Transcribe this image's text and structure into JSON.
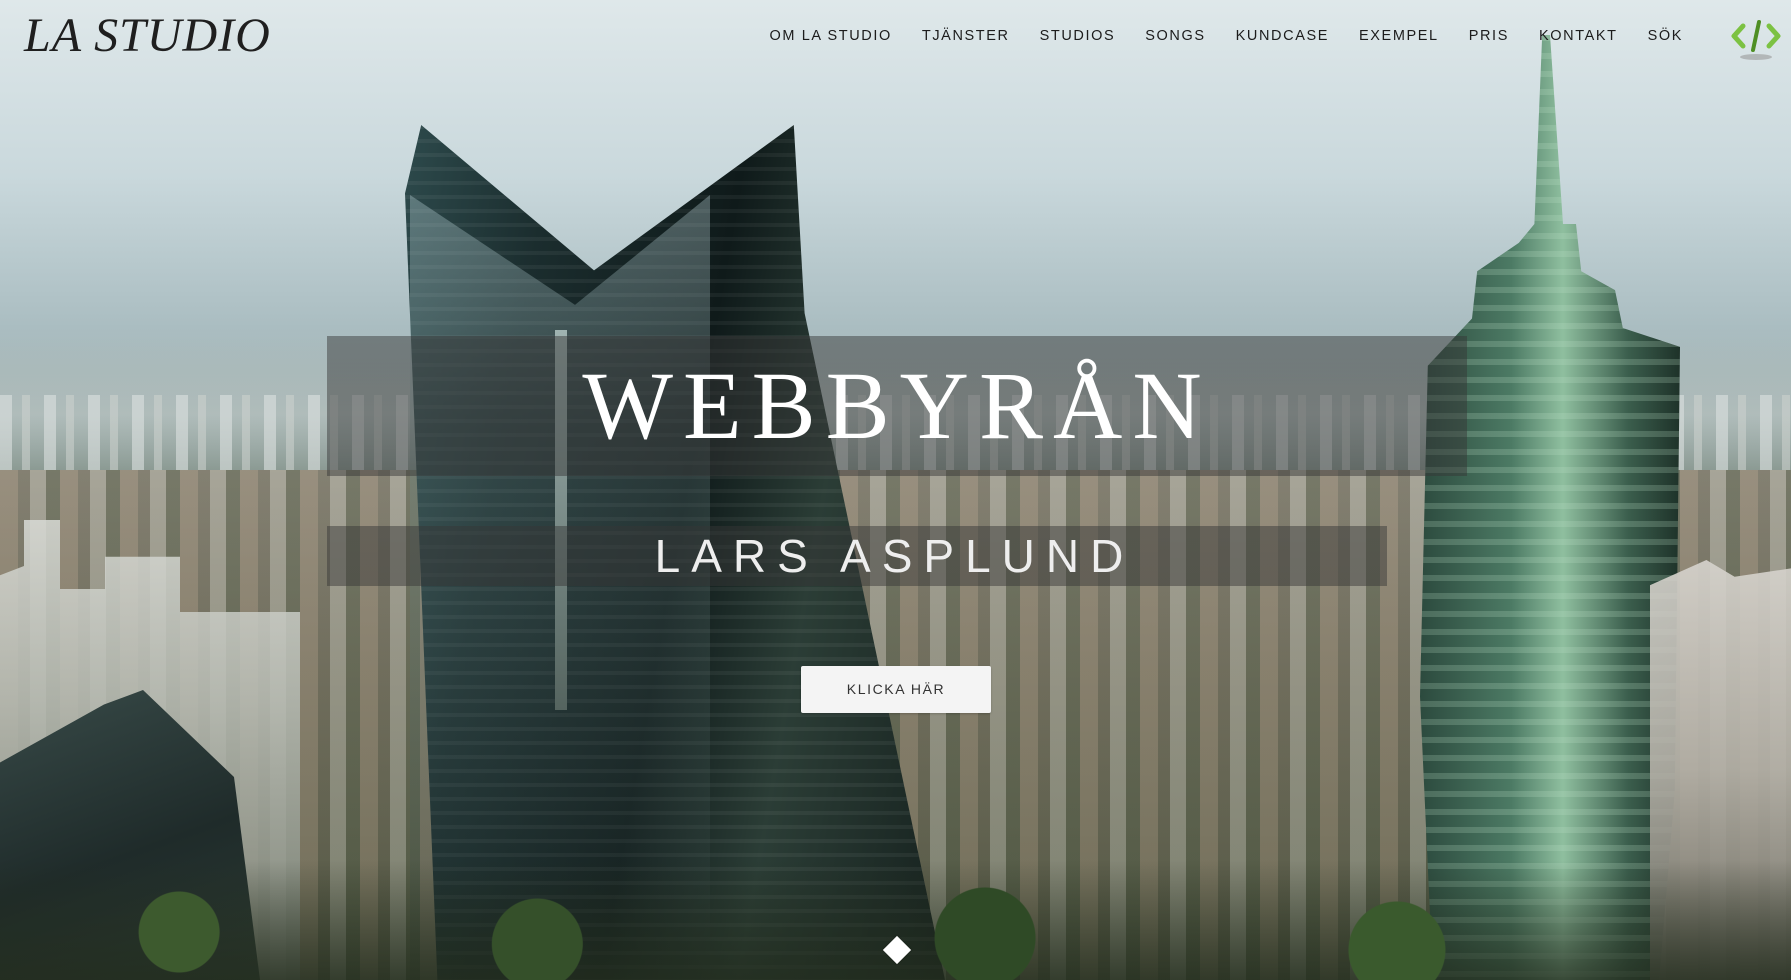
{
  "header": {
    "logo": "LA STUDIO",
    "nav": [
      {
        "label": "OM LA STUDIO"
      },
      {
        "label": "TJÄNSTER"
      },
      {
        "label": "STUDIOS"
      },
      {
        "label": "SONGS"
      },
      {
        "label": "KUNDCASE"
      },
      {
        "label": "EXEMPEL"
      },
      {
        "label": "PRIS"
      },
      {
        "label": "KONTAKT"
      },
      {
        "label": "SÖK"
      }
    ],
    "code_icon": "code-brackets-icon"
  },
  "hero": {
    "title": "WEBBYRÅN",
    "subtitle": "LARS ASPLUND",
    "cta_label": "KLICKA HÄR",
    "scroll_icon": "diamond-down-icon",
    "background": "city-skyline-photo"
  },
  "colors": {
    "logo": "#1f1f1f",
    "nav_text": "#1c1c1c",
    "title_text": "#ffffff",
    "band": "#373737",
    "cta_bg": "#f4f4f4",
    "code_icon_green": "#7cc242"
  }
}
